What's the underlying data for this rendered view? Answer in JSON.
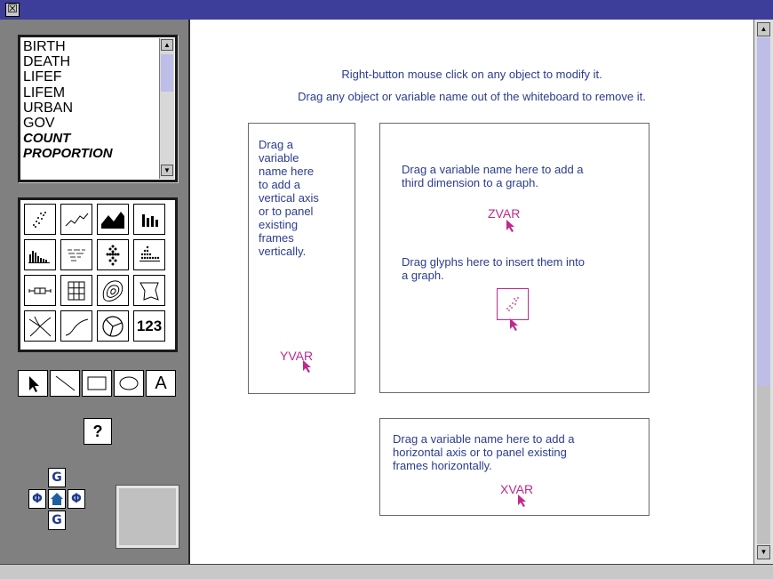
{
  "window": {
    "close_glyph": "☒"
  },
  "variables": [
    "BIRTH",
    "DEATH",
    "LIFEF",
    "LIFEM",
    "URBAN",
    "GOV",
    "COUNT",
    "PROPORTION"
  ],
  "glyph_palette": [
    "scatter-glyph",
    "line-glyph",
    "area-glyph",
    "bar-glyph",
    "histogram-glyph",
    "text-cloud-glyph",
    "dot-tree-glyph",
    "dot-plot-glyph",
    "boxplot-glyph",
    "grid-glyph",
    "contour-glyph",
    "shape-glyph",
    "network-glyph",
    "curve-glyph",
    "pie-glyph",
    "number-glyph"
  ],
  "number_glyph_label": "123",
  "tools": {
    "text_tool_label": "A",
    "help_label": "?"
  },
  "nav": {
    "up": "G",
    "down": "G",
    "left": "Φ",
    "right": "Φ",
    "home": "⌂"
  },
  "whiteboard": {
    "instruction1": "Right-button mouse click on any object to modify it.",
    "instruction2": "Drag any object or variable name out of the whiteboard to remove it.",
    "vertical_box_lines": [
      "Drag a",
      "variable",
      "name here",
      "to add a",
      "vertical axis",
      "or to panel",
      "existing",
      "frames",
      "vertically."
    ],
    "yvar": "YVAR",
    "zvar_lines": [
      "Drag a variable name here to add a",
      "third dimension to a graph."
    ],
    "zvar": "ZVAR",
    "glyph_lines": [
      "Drag glyphs here to insert them into",
      "a graph."
    ],
    "xvar_lines": [
      "Drag a variable name here to add a",
      "horizontal axis or to panel existing",
      "frames horizontally."
    ],
    "xvar": "XVAR"
  },
  "colors": {
    "instruction_text": "#2b3c8f",
    "var_label": "#c02a8c",
    "titlebar": "#3d3d9a"
  }
}
